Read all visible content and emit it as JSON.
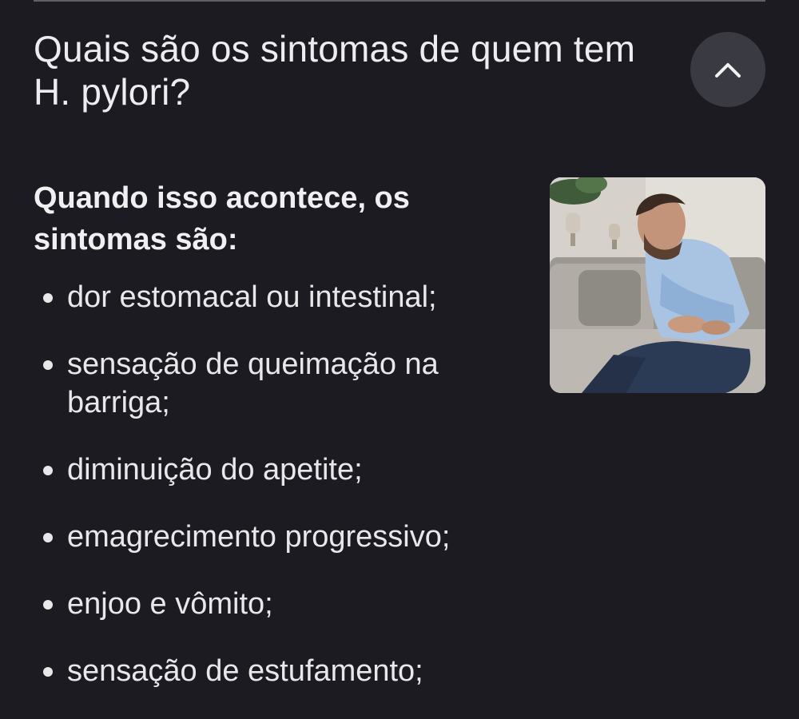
{
  "faq": {
    "question": "Quais são os sintomas de quem tem H. pylori?",
    "collapse_icon": "chevron-up-icon"
  },
  "answer": {
    "title": "Quando isso acontece, os sintomas são:",
    "symptoms": [
      "dor estomacal ou intestinal;",
      "sensação de queimação na barriga;",
      "diminuição do apetite;",
      "emagrecimento progressivo;",
      "enjoo e vômito;",
      "sensação de estufamento;"
    ]
  },
  "image": {
    "subject": "man holding stomach in pain on sofa"
  },
  "colors": {
    "background": "#1c1b22",
    "text": "#e8e8ea",
    "button": "#3a3b42"
  }
}
